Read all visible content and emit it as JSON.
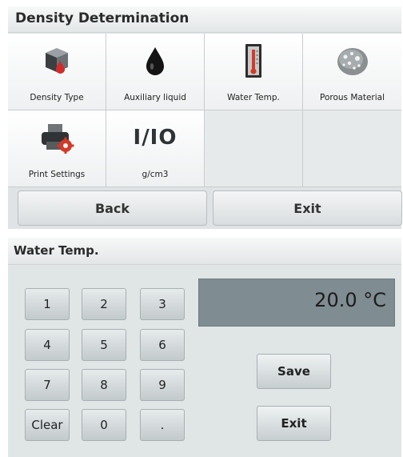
{
  "density_screen": {
    "title": "Density Determination",
    "items": [
      {
        "label": "Density Type",
        "icon": "sample-cube-icon"
      },
      {
        "label": "Auxiliary liquid",
        "icon": "liquid-drop-icon"
      },
      {
        "label": "Water Temp.",
        "icon": "thermometer-icon"
      },
      {
        "label": "Porous Material",
        "icon": "porous-material-icon"
      },
      {
        "label": "Print Settings",
        "icon": "printer-settings-icon"
      },
      {
        "label": "g/cm3",
        "icon": "io-units-icon",
        "icon_text": "I/IO"
      }
    ],
    "back_label": "Back",
    "exit_label": "Exit"
  },
  "water_temp_screen": {
    "title": "Water Temp.",
    "keypad": [
      "1",
      "2",
      "3",
      "4",
      "5",
      "6",
      "7",
      "8",
      "9",
      "Clear",
      "0",
      "."
    ],
    "display_value": "20.0 °C",
    "save_label": "Save",
    "exit_label": "Exit"
  },
  "colors": {
    "panel_bg": "#e0e5e6",
    "display_bg": "#7f8c92",
    "accent_red": "#d63a2a"
  }
}
